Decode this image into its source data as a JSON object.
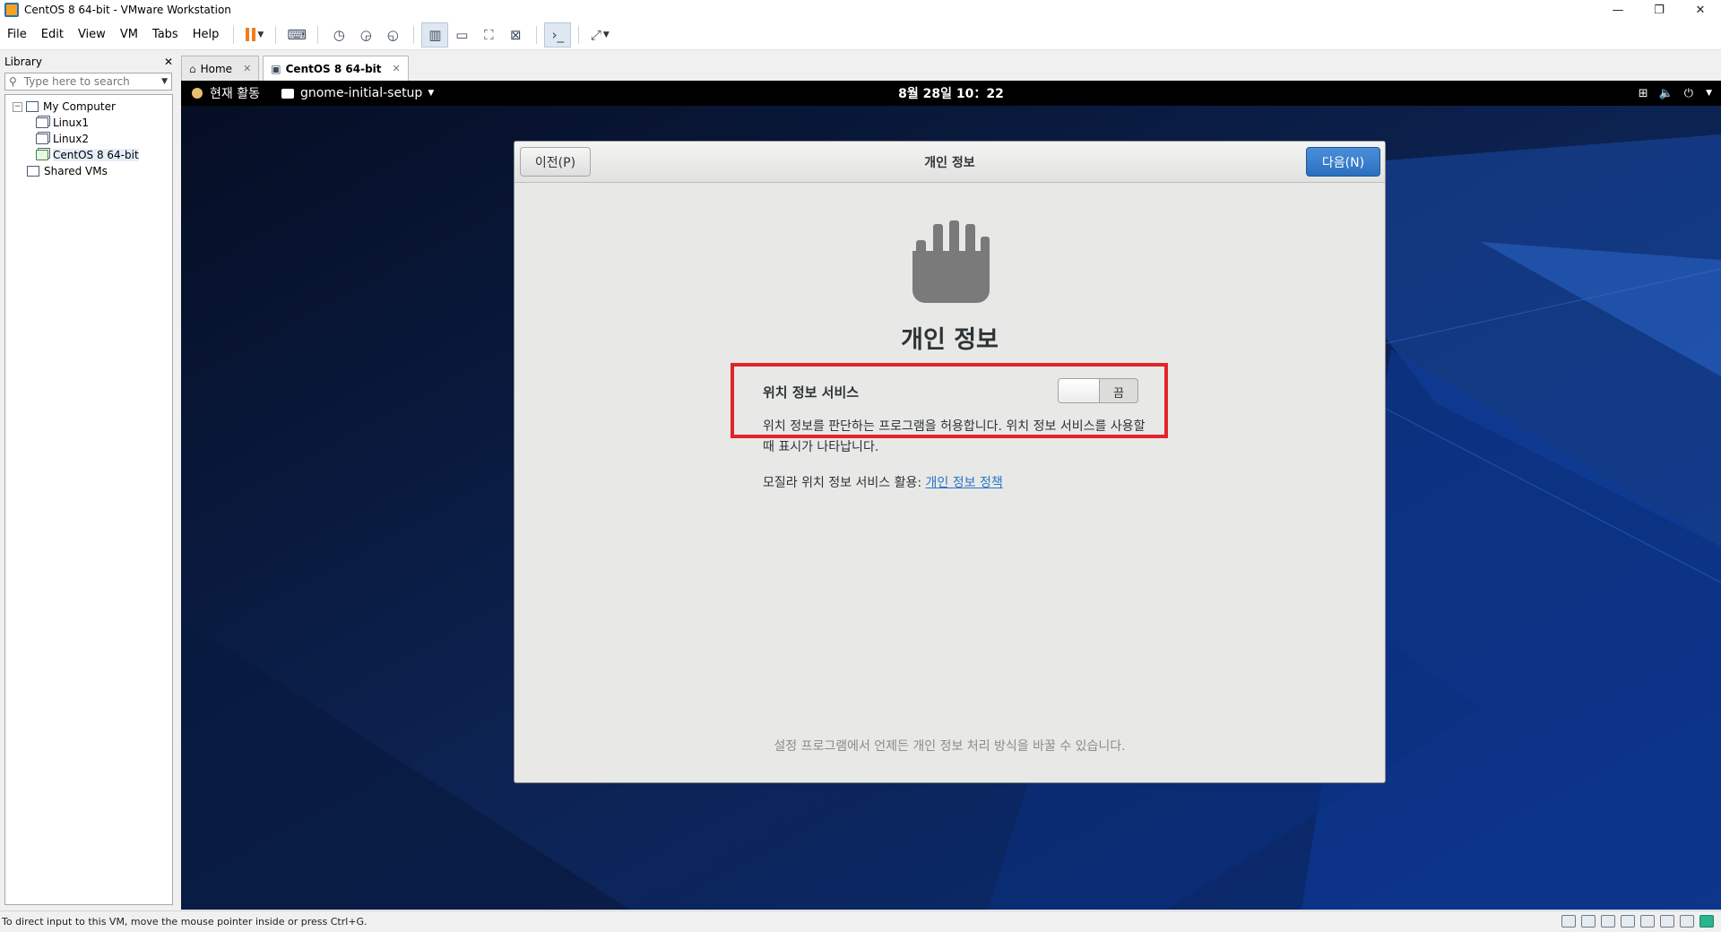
{
  "window": {
    "title": "CentOS 8 64-bit - VMware Workstation",
    "controls": [
      "—",
      "❐",
      "✕"
    ]
  },
  "menu": [
    "File",
    "Edit",
    "View",
    "VM",
    "Tabs",
    "Help"
  ],
  "library": {
    "title": "Library",
    "close": "✕",
    "search_placeholder": "Type here to search",
    "tree": {
      "root": "My Computer",
      "children": [
        "Linux1",
        "Linux2",
        "CentOS 8 64-bit"
      ],
      "shared": "Shared VMs",
      "selected": "CentOS 8 64-bit"
    }
  },
  "tabs": [
    {
      "label": "Home",
      "active": false
    },
    {
      "label": "CentOS 8 64-bit",
      "active": true
    }
  ],
  "gnome": {
    "activities": "현재 활동",
    "app_menu": "gnome-initial-setup",
    "clock": "8월 28일  10：22"
  },
  "dialog": {
    "prev": "이전(P)",
    "next": "다음(N)",
    "header_title": "개인 정보",
    "page_title": "개인 정보",
    "location_label": "위치 정보 서비스",
    "switch_state": "끔",
    "switch_on": false,
    "description": "위치 정보를 판단하는 프로그램을 허용합니다. 위치 정보 서비스를 사용할 때 표시가 나타납니다.",
    "policy_prefix": "모질라 위치 정보 서비스 활용: ",
    "policy_link": "개인 정보 정책",
    "footer": "설정 프로그램에서 언제든 개인 정보 처리 방식을 바꿀 수 있습니다."
  },
  "statusbar": {
    "message": "To direct input to this VM, move the mouse pointer inside or press Ctrl+G."
  },
  "colors": {
    "highlight": "#e1242b",
    "accent": "#2c6fc0",
    "desktop": "#0b1a3a"
  }
}
